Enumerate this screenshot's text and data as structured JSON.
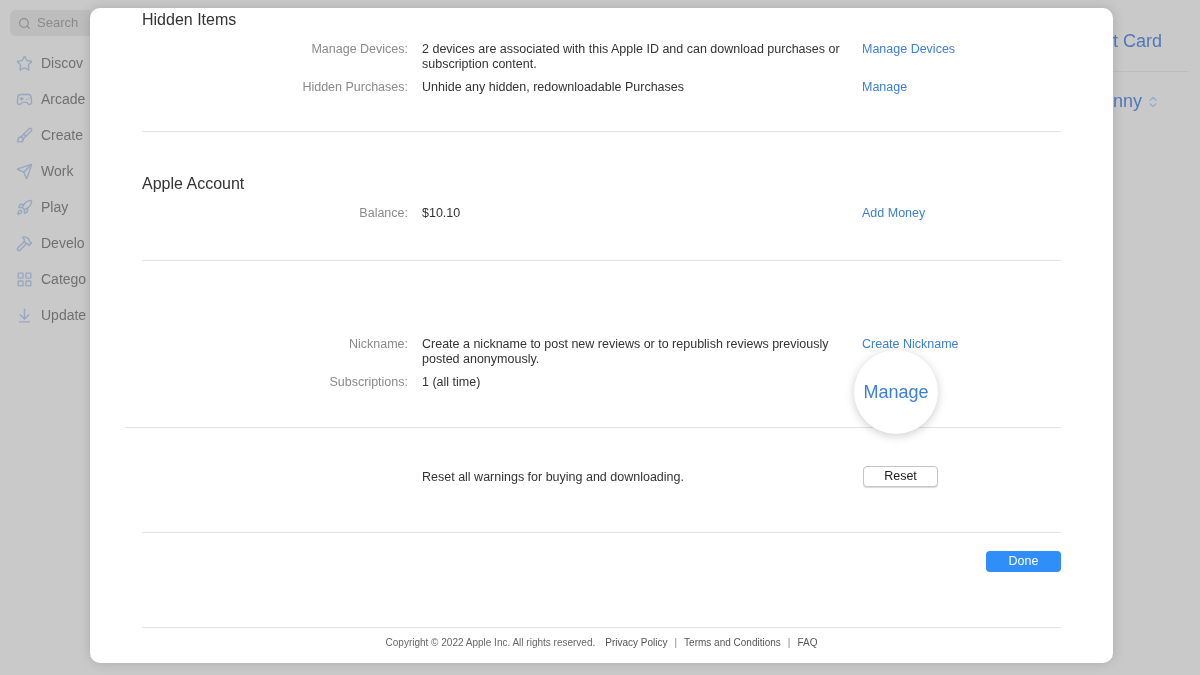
{
  "background": {
    "search": {
      "placeholder": "Search"
    },
    "sidebar_items": [
      {
        "label": "Discov"
      },
      {
        "label": "Arcade"
      },
      {
        "label": "Create"
      },
      {
        "label": "Work"
      },
      {
        "label": "Play"
      },
      {
        "label": "Develo"
      },
      {
        "label": "Catego"
      },
      {
        "label": "Update"
      }
    ],
    "right_texts": [
      "t Card",
      "nny"
    ]
  },
  "sections": [
    {
      "heading": "Hidden Items",
      "rows": [
        {
          "label": "Manage Devices:",
          "value": "2 devices are associated with this Apple ID and can download purchases or subscription content.",
          "link": "Manage Devices"
        },
        {
          "label": "Hidden Purchases:",
          "value": "Unhide any hidden, redownloadable Purchases",
          "link": "Manage"
        }
      ]
    },
    {
      "heading": "Apple Account",
      "rows": [
        {
          "label": "Balance:",
          "value": "$10.10",
          "link": "Add Money"
        }
      ]
    },
    {
      "rows": [
        {
          "label": "Nickname:",
          "value": "Create a nickname to post new reviews or to republish reviews previously posted anonymously.",
          "link": "Create Nickname"
        },
        {
          "label": "Subscriptions:",
          "value": "1 (all time)",
          "magnified_link": "Manage"
        }
      ]
    }
  ],
  "reset": {
    "text": "Reset all warnings for buying and downloading.",
    "button": "Reset"
  },
  "done_button": "Done",
  "footer": {
    "copyright": "Copyright © 2022 Apple Inc. All rights reserved.",
    "links": [
      "Privacy Policy",
      "Terms and Conditions",
      "FAQ"
    ],
    "separator": "|"
  }
}
